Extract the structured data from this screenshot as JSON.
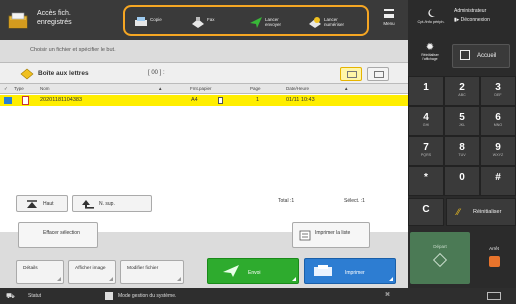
{
  "header": {
    "app_title": "Accès fich. enregistrés",
    "quick_tools": [
      "Copie",
      "Fax",
      "Lancer envoyer",
      "Lancer numériser"
    ],
    "menu_label": "Menu"
  },
  "right_panel": {
    "counter_label": "Cpt./Info périph.",
    "admin_label": "Administrateur",
    "logout_label": "Déconnexion",
    "reset_label": "Réinitialiser l'affichage",
    "home_label": "Accueil",
    "keys": [
      {
        "n": "1",
        "s": ""
      },
      {
        "n": "2",
        "s": "ABC"
      },
      {
        "n": "3",
        "s": "DEF"
      },
      {
        "n": "4",
        "s": "GHI"
      },
      {
        "n": "5",
        "s": "JKL"
      },
      {
        "n": "6",
        "s": "MNO"
      },
      {
        "n": "7",
        "s": "PQRS"
      },
      {
        "n": "8",
        "s": "TUV"
      },
      {
        "n": "9",
        "s": "WXYZ"
      },
      {
        "n": "*",
        "s": ""
      },
      {
        "n": "0",
        "s": ""
      },
      {
        "n": "#",
        "s": ""
      }
    ],
    "clear_label": "C",
    "reinit_label": "Réinitialiser",
    "start_label": "Départ",
    "stop_label": "Arrêt"
  },
  "main": {
    "instruction": "Choisir un fichier et spécifier le but.",
    "box_name": "Boîte aux lettres",
    "box_count": "[ 00 ] :",
    "columns": [
      "Type",
      "Nom",
      "Fmt.papier",
      "Page",
      "Date/Heure"
    ],
    "rows": [
      {
        "name": "20201181104383",
        "paper": "A4",
        "pages": "1",
        "datetime": "01/11  10:43"
      }
    ],
    "nav_first": "Haut",
    "nav_up": "N. sup.",
    "total": "Total :1",
    "selected": "Sélect. :1",
    "clear_sel": "Effacer sélection",
    "print_list": "Imprimer la liste",
    "details": "Détails",
    "show_image": "Afficher image",
    "edit_file": "Modifier fichier",
    "send": "Envoi",
    "print": "Imprimer"
  },
  "status": {
    "left": "Statut",
    "message": "Mode gestion du système."
  },
  "colors": {
    "accent_orange": "#f5a623",
    "selected_row": "#ffee00",
    "send_green": "#2eab2e",
    "print_blue": "#2d7dd2"
  }
}
